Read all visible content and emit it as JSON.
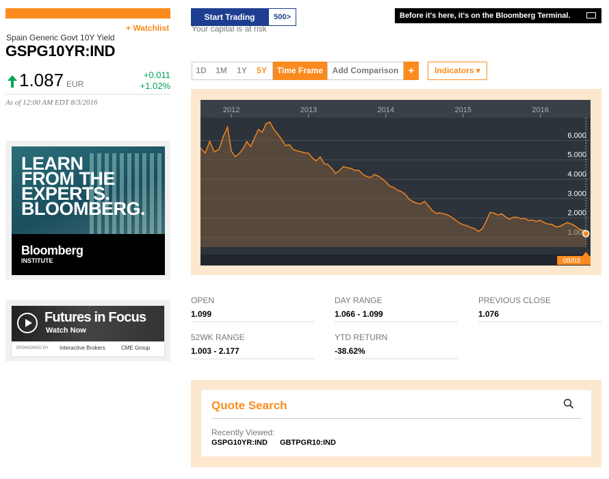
{
  "header": {
    "watchlist_label": "+ Watchlist",
    "security_name": "Spain Generic Govt 10Y Yield",
    "ticker": "GSPG10YR:IND",
    "price": "1.087",
    "currency": "EUR",
    "change": "+0.011",
    "change_pct": "+1.02%",
    "as_of": "As of 12:00 AM EDT 8/3/2016"
  },
  "promo": {
    "start_trading": "Start Trading",
    "s500": "500>",
    "risk": "Your capital is at risk",
    "terminal": "Before it's here, it's on the Bloomberg Terminal."
  },
  "ads": {
    "ad1_text": "LEARN\nFROM THE\nEXPERTS.\nBLOOMBERG.",
    "ad1_brand": "Bloomberg",
    "ad1_sub": "INSTITUTE",
    "ad2_title": "Futures in Focus",
    "ad2_watch": "Watch Now",
    "ad2_sponsor": "SPONSORED BY",
    "ad2_ib": "Interactive Brokers",
    "ad2_cme": "CME Group"
  },
  "controls": {
    "tf_1d": "1D",
    "tf_1m": "1M",
    "tf_1y": "1Y",
    "tf_5y": "5Y",
    "time_frame": "Time Frame",
    "add_comparison": "Add Comparison",
    "add_plus": "+",
    "indicators": "Indicators ▾"
  },
  "colors": {
    "accent": "#fb8b1e",
    "positive": "#00a35a",
    "chart_bg": "#2d333b",
    "cta_blue": "#1e3f91"
  },
  "chart_data": {
    "type": "area",
    "x_tick_labels": [
      "2012",
      "2013",
      "2014",
      "2015",
      "2016"
    ],
    "y_tick_labels": [
      "6.000",
      "5.000",
      "4.000",
      "3.000",
      "2.000",
      "1.000"
    ],
    "ylim": [
      0.4,
      7.0
    ],
    "xlim": [
      2011.6,
      2016.65
    ],
    "grid": true,
    "last_point": {
      "label_date": "08/03",
      "label_value": "1.087",
      "x": 2016.59,
      "y": 1.087
    },
    "series": [
      {
        "x": [
          2011.6,
          2011.66,
          2011.72,
          2011.78,
          2011.84,
          2011.9,
          2011.95,
          2012.0,
          2012.05,
          2012.1,
          2012.15,
          2012.2,
          2012.25,
          2012.3,
          2012.35,
          2012.4,
          2012.45,
          2012.5,
          2012.55,
          2012.6,
          2012.65,
          2012.7,
          2012.75,
          2012.8,
          2012.85,
          2012.9,
          2012.95,
          2013.0,
          2013.05,
          2013.1,
          2013.15,
          2013.2,
          2013.25,
          2013.3,
          2013.35,
          2013.4,
          2013.45,
          2013.5,
          2013.55,
          2013.6,
          2013.65,
          2013.7,
          2013.75,
          2013.8,
          2013.85,
          2013.9,
          2013.95,
          2014.0,
          2014.05,
          2014.1,
          2014.15,
          2014.2,
          2014.25,
          2014.3,
          2014.35,
          2014.4,
          2014.45,
          2014.5,
          2014.55,
          2014.6,
          2014.65,
          2014.7,
          2014.75,
          2014.8,
          2014.85,
          2014.9,
          2014.95,
          2015.0,
          2015.05,
          2015.1,
          2015.15,
          2015.2,
          2015.25,
          2015.3,
          2015.35,
          2015.4,
          2015.45,
          2015.5,
          2015.55,
          2015.6,
          2015.65,
          2015.7,
          2015.75,
          2015.8,
          2015.85,
          2015.9,
          2015.95,
          2016.0,
          2016.05,
          2016.1,
          2016.15,
          2016.2,
          2016.25,
          2016.3,
          2016.35,
          2016.4,
          2016.45,
          2016.5,
          2016.55,
          2016.59
        ],
        "y": [
          5.5,
          5.2,
          5.8,
          5.3,
          5.5,
          6.2,
          6.6,
          5.3,
          5.0,
          5.2,
          5.5,
          5.9,
          5.6,
          6.0,
          6.4,
          6.3,
          6.8,
          6.9,
          6.5,
          6.2,
          5.9,
          5.6,
          5.7,
          5.5,
          5.4,
          5.3,
          5.2,
          5.2,
          5.0,
          4.9,
          5.1,
          4.7,
          4.6,
          4.4,
          4.2,
          4.4,
          4.6,
          4.5,
          4.4,
          4.3,
          4.35,
          4.2,
          4.1,
          4.0,
          4.1,
          4.0,
          3.9,
          3.8,
          3.6,
          3.5,
          3.3,
          3.2,
          3.1,
          2.9,
          2.8,
          2.7,
          2.6,
          2.7,
          2.5,
          2.3,
          2.2,
          2.2,
          2.1,
          2.0,
          1.9,
          1.8,
          1.7,
          1.6,
          1.5,
          1.35,
          1.3,
          1.2,
          1.4,
          1.8,
          2.2,
          2.1,
          2.0,
          2.1,
          2.0,
          1.9,
          1.95,
          1.9,
          1.8,
          1.85,
          1.8,
          1.85,
          1.75,
          1.75,
          1.6,
          1.55,
          1.6,
          1.5,
          1.5,
          1.55,
          1.6,
          1.55,
          1.5,
          1.4,
          1.3,
          1.087
        ]
      }
    ]
  },
  "stats": [
    {
      "label": "OPEN",
      "value": "1.099"
    },
    {
      "label": "DAY RANGE",
      "value": "1.066 - 1.099"
    },
    {
      "label": "PREVIOUS CLOSE",
      "value": "1.076"
    },
    {
      "label": "52WK RANGE",
      "value": "1.003 - 2.177"
    },
    {
      "label": "YTD RETURN",
      "value": "-38.62%"
    }
  ],
  "quote_search": {
    "title": "Quote Search",
    "recently_viewed_label": "Recently Viewed:",
    "recent": [
      "GSPG10YR:IND",
      "GBTPGR10:IND"
    ]
  }
}
